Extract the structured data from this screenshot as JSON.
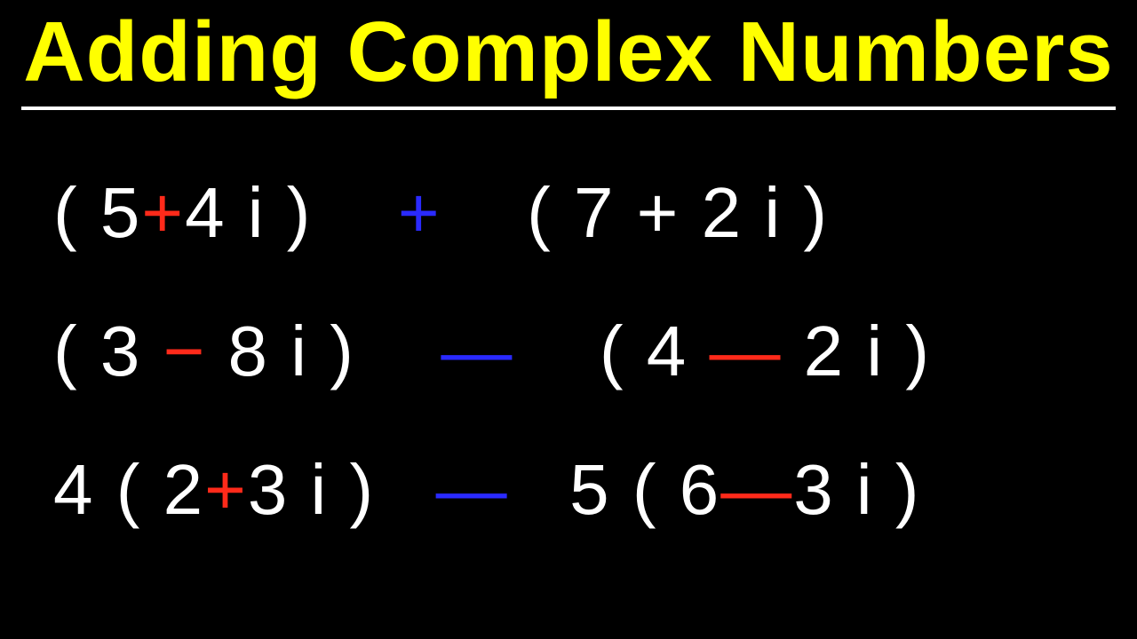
{
  "title": "Adding Complex Numbers",
  "lines": {
    "l1": {
      "p1open": "( 5",
      "p1op": "+",
      "p1rest": "4 i )",
      "midop": "+",
      "p2": "( 7 + 2 i )"
    },
    "l2": {
      "p1open": "( 3 ",
      "p1op": "−",
      "p1rest": " 8 i )",
      "midop": "—",
      "p2open": "( 4 ",
      "p2op": "—",
      "p2rest": " 2 i )"
    },
    "l3": {
      "coef1": "4",
      "p1open": " ( 2",
      "p1op": "+",
      "p1rest": "3 i )",
      "midop": "—",
      "coef2": "5",
      "p2open": " ( 6",
      "p2op": "—",
      "p2rest": "3 i )"
    }
  }
}
